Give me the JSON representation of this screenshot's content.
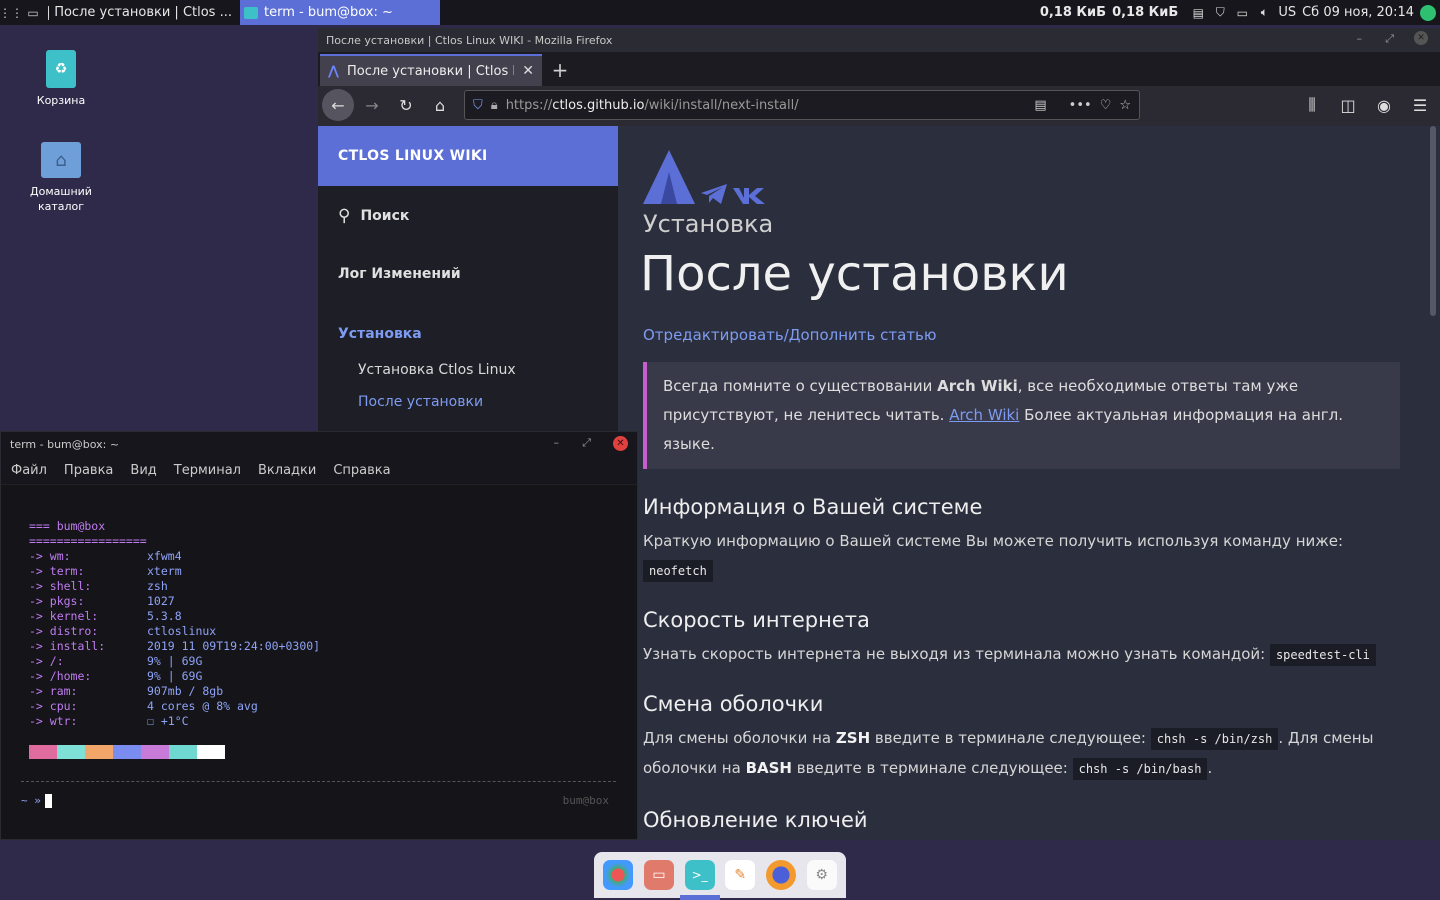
{
  "top_panel": {
    "task1_title": "После установки | Ctlos ...",
    "task2_title": "term - bum@box: ~",
    "net_down": "0,18 КиБ",
    "net_up": "0,18 КиБ",
    "layout": "US",
    "clock": "Сб 09 ноя, 20:14"
  },
  "desktop": {
    "trash_label": "Корзина",
    "home_label": "Домашний каталог"
  },
  "firefox": {
    "window_title": "После установки | Ctlos Linux WIKI - Mozilla Firefox",
    "tab_title": "После установки | Ctlos L",
    "url_scheme": "https://",
    "url_host": "ctlos.github.io",
    "url_path": "/wiki/install/next-install/"
  },
  "sidebar": {
    "brand": "CTLOS LINUX WIKI",
    "search": "Поиск",
    "changelog": "Лог Изменений",
    "install_section": "Установка",
    "items": [
      "Установка Ctlos Linux",
      "После установки"
    ]
  },
  "article": {
    "kicker": "Установка",
    "title": "После установки",
    "edit_link": "Отредактировать/Дополнить статью",
    "note_pre": "Всегда помните о существовании ",
    "note_bold": "Arch Wiki",
    "note_mid": ", все необходимые ответы там уже присутствуют, не ленитесь читать. ",
    "note_link": "Arch Wiki",
    "note_post": " Более актуальная информация на англ. языке.",
    "sec1_title": "Информация о Вашей системе",
    "sec1_text": "Краткую информацию о Вашей системе Вы можете получить используя команду ниже: ",
    "sec1_code": "neofetch",
    "sec2_title": "Скорость интернета",
    "sec2_text": "Узнать скорость интернета не выходя из терминала можно узнать командой: ",
    "sec2_code": "speedtest-cli",
    "sec3_title": "Смена оболочки",
    "sec3_t1": "Для смены оболочки на ",
    "sec3_b1": "ZSH",
    "sec3_t2": " введите в терминале следующее: ",
    "sec3_c1": "chsh -s /bin/zsh",
    "sec3_t3": ". Для смены оболочки на ",
    "sec3_b2": "BASH",
    "sec3_t4": " введите в терминале следующее: ",
    "sec3_c2": "chsh -s /bin/bash",
    "sec3_t5": ".",
    "sec4_title": "Обновление ключей"
  },
  "terminal": {
    "title": "term - bum@box: ~",
    "menu": [
      "Файл",
      "Правка",
      "Вид",
      "Терминал",
      "Вкладки",
      "Справка"
    ],
    "header": "=== bum@box",
    "separator": "=================",
    "rows": [
      {
        "k": "-> wm:",
        "v": "xfwm4"
      },
      {
        "k": "-> term:",
        "v": "xterm"
      },
      {
        "k": "-> shell:",
        "v": "zsh"
      },
      {
        "k": "-> pkgs:",
        "v": "1027"
      },
      {
        "k": "-> kernel:",
        "v": "5.3.8"
      },
      {
        "k": "-> distro:",
        "v": "ctloslinux"
      },
      {
        "k": "-> install:",
        "v": "2019 11 09T19:24:00+0300]"
      },
      {
        "k": "-> /:",
        "v": "9% | 69G"
      },
      {
        "k": "-> /home:",
        "v": "9% | 69G"
      },
      {
        "k": "-> ram:",
        "v": "907mb / 8gb"
      },
      {
        "k": "-> cpu:",
        "v": "4 cores @ 8% avg"
      },
      {
        "k": "-> wtr:",
        "v": "☐ +1°C"
      }
    ],
    "palette": [
      "#e06c9f",
      "#7ee0d6",
      "#f2a66a",
      "#7a8cf0",
      "#c77ad8",
      "#6fd8d0",
      "#ffffff"
    ],
    "prompt": "~ »",
    "prompt_right": "bum@box"
  },
  "colors": {
    "accent": "#5b6fd6",
    "link": "#7e9bf2",
    "note_border": "#c75ed0"
  }
}
